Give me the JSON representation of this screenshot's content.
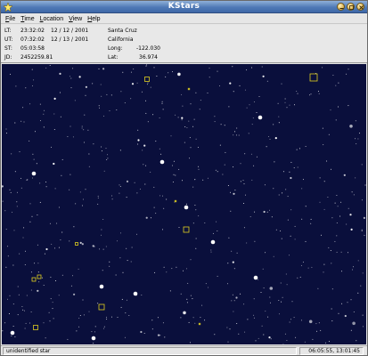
{
  "window": {
    "title": "KStars",
    "icon": "kstars-app-icon",
    "controls": [
      "minimize-icon",
      "maximize-icon",
      "close-icon"
    ]
  },
  "menu": {
    "items": [
      {
        "label": "File"
      },
      {
        "label": "Time"
      },
      {
        "label": "Location"
      },
      {
        "label": "View"
      },
      {
        "label": "Help"
      }
    ]
  },
  "info": {
    "lt": {
      "label": "LT:",
      "time": "23:32:02",
      "date": "12 / 12 / 2001"
    },
    "ut": {
      "label": "UT:",
      "time": "07:32:02",
      "date": "12 / 13 / 2001"
    },
    "st": {
      "label": "ST:",
      "time": "05:03:58"
    },
    "jd": {
      "label": "JD:",
      "value": "2452259.81"
    },
    "city": "Santa Cruz",
    "region": "California",
    "long": {
      "label": "Long:",
      "value": "-122.030"
    },
    "lat": {
      "label": "Lat:",
      "value": "36.974"
    }
  },
  "sky": {
    "background": "#0a0f3c",
    "marker_color": "#e0d020"
  },
  "status": {
    "object": "unidentified star",
    "coords": "06:05:55,  13:01:45"
  }
}
